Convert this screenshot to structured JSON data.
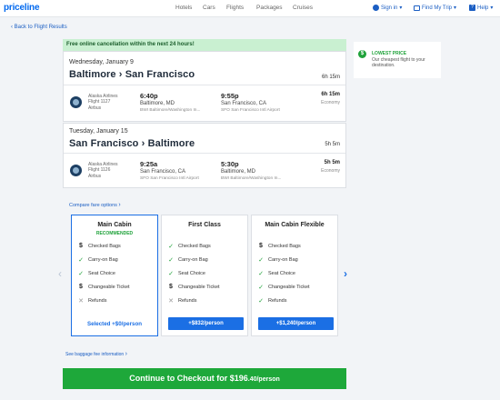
{
  "header": {
    "logo": "priceline",
    "nav": [
      "Hotels",
      "Cars",
      "Flights",
      "Packages",
      "Cruises"
    ],
    "sign_in": "Sign in",
    "find_trip": "Find My Trip",
    "help": "Help"
  },
  "back_link": "Back to Flight Results",
  "promo": "Free online cancellation within the next 24 hours!",
  "segments": [
    {
      "date": "Wednesday, January 9",
      "route": "Baltimore › San Francisco",
      "duration": "6h 15m",
      "airline": "Alaska Airlines",
      "flight": "Flight 1127",
      "aircraft": "Airbus",
      "depart_time": "6:40p",
      "depart_city": "Baltimore, MD",
      "depart_airport": "BWI Baltimore/Washington In...",
      "arrive_time": "9:55p",
      "arrive_city": "San Francisco, CA",
      "arrive_airport": "SFO San Francisco Intl Airport",
      "leg_duration": "6h 15m",
      "cabin": "Economy"
    },
    {
      "date": "Tuesday, January 15",
      "route": "San Francisco › Baltimore",
      "duration": "5h 5m",
      "airline": "Alaska Airlines",
      "flight": "Flight 1126",
      "aircraft": "Airbus",
      "depart_time": "9:25a",
      "depart_city": "San Francisco, CA",
      "depart_airport": "SFO San Francisco Intl Airport",
      "arrive_time": "5:30p",
      "arrive_city": "Baltimore, MD",
      "arrive_airport": "BWI Baltimore/Washington In...",
      "leg_duration": "5h 5m",
      "cabin": "Economy"
    }
  ],
  "lowest_price": {
    "title": "LOWEST PRICE",
    "text": "Our cheapest flight to your destination."
  },
  "compare_link": "Compare fare options",
  "fares": [
    {
      "title": "Main Cabin",
      "badge": "RECOMMENDED",
      "features": [
        {
          "icon": "dollar-icon",
          "label": "Checked Bags"
        },
        {
          "icon": "check-icon",
          "label": "Carry-on Bag"
        },
        {
          "icon": "check-icon",
          "label": "Seat Choice"
        },
        {
          "icon": "dollar-icon",
          "label": "Changeable Ticket"
        },
        {
          "icon": "x-icon",
          "label": "Refunds"
        }
      ],
      "action": "Selected +$0/person"
    },
    {
      "title": "First Class",
      "features": [
        {
          "icon": "check-icon",
          "label": "Checked Bags"
        },
        {
          "icon": "check-icon",
          "label": "Carry-on Bag"
        },
        {
          "icon": "check-icon",
          "label": "Seat Choice"
        },
        {
          "icon": "dollar-icon",
          "label": "Changeable Ticket"
        },
        {
          "icon": "x-icon",
          "label": "Refunds"
        }
      ],
      "action": "+$832/person"
    },
    {
      "title": "Main Cabin Flexible",
      "features": [
        {
          "icon": "dollar-icon",
          "label": "Checked Bags"
        },
        {
          "icon": "check-icon",
          "label": "Carry-on Bag"
        },
        {
          "icon": "check-icon",
          "label": "Seat Choice"
        },
        {
          "icon": "check-icon",
          "label": "Changeable Ticket"
        },
        {
          "icon": "check-icon",
          "label": "Refunds"
        }
      ],
      "action": "+$1,240/person"
    }
  ],
  "baggage_link": "See baggage fee information",
  "checkout": {
    "label": "Continue to Checkout for $196",
    "cents": ".40/person"
  },
  "colors": {
    "brand": "#0068ef",
    "link": "#1b5ec3",
    "button": "#1b6fe4",
    "success": "#1ea83a",
    "promo_bg": "#c9f0d1"
  }
}
